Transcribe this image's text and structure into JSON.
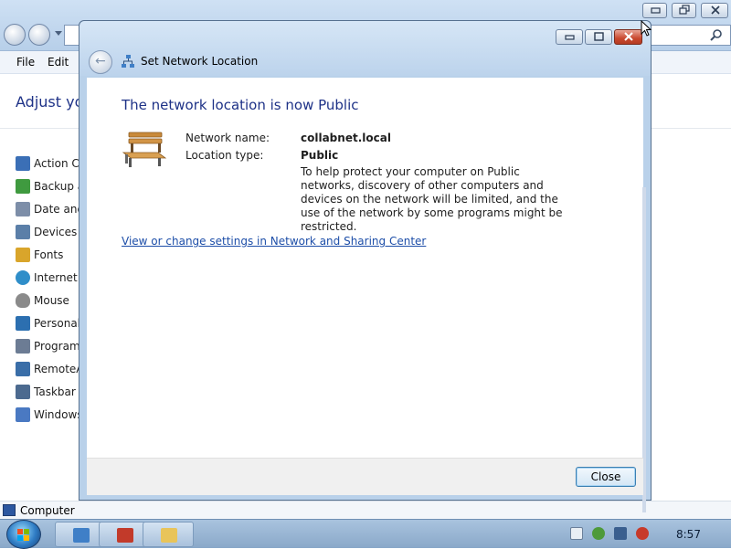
{
  "background_window": {
    "menu": {
      "file": "File",
      "edit": "Edit"
    },
    "heading": "Adjust you",
    "items": [
      {
        "label": "Action Ce",
        "icon": "flag-icon",
        "color": "#3b6fb6"
      },
      {
        "label": "Backup a",
        "icon": "backup-icon",
        "color": "#3f9a3f"
      },
      {
        "label": "Date and",
        "icon": "calendar-icon",
        "color": "#7d8ea8"
      },
      {
        "label": "Devices a",
        "icon": "devices-icon",
        "color": "#5b7fa8"
      },
      {
        "label": "Fonts",
        "icon": "fonts-icon",
        "color": "#d9a52b"
      },
      {
        "label": "Internet C",
        "icon": "globe-icon",
        "color": "#2f8ec9"
      },
      {
        "label": "Mouse",
        "icon": "mouse-icon",
        "color": "#8a8a8a"
      },
      {
        "label": "Personaliz",
        "icon": "monitor-icon",
        "color": "#2c6fb0"
      },
      {
        "label": "Programs",
        "icon": "programs-icon",
        "color": "#6c7c94"
      },
      {
        "label": "RemoteA",
        "icon": "remoteapp-icon",
        "color": "#3a6ea8"
      },
      {
        "label": "Taskbar a",
        "icon": "taskbar-icon",
        "color": "#4c6a8f"
      },
      {
        "label": "Windows",
        "icon": "windows-update-icon",
        "color": "#4a79c2"
      }
    ],
    "status": "Computer"
  },
  "dialog": {
    "title": "Set Network Location",
    "heading": "The network location is now Public",
    "network_name_label": "Network name:",
    "network_name": "collabnet.local",
    "location_type_label": "Location type:",
    "location_type": "Public",
    "description": "To help protect your computer on Public networks, discovery of other computers and devices on the network will be limited, and the use of the network by some programs might be restricted.",
    "link": "View or change settings in Network and Sharing Center",
    "close_button": "Close"
  },
  "taskbar": {
    "clock": "8:57"
  }
}
